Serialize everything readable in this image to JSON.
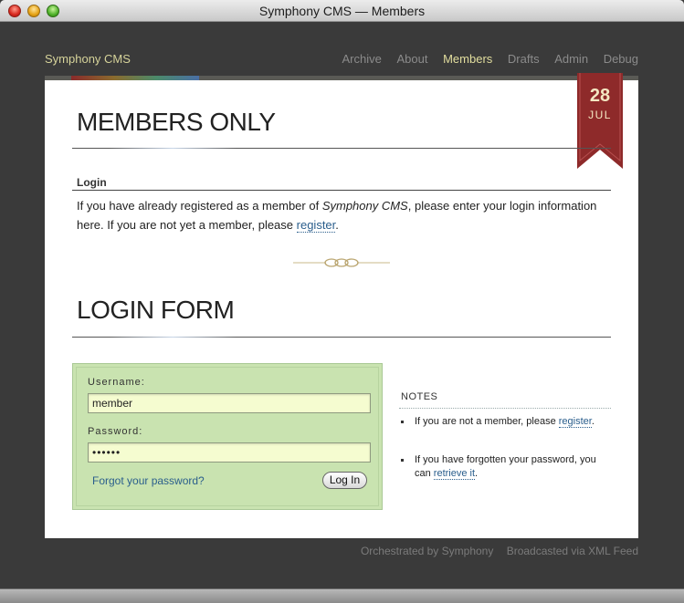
{
  "window": {
    "title": "Symphony CMS — Members"
  },
  "header": {
    "site_name": "Symphony CMS",
    "nav": [
      {
        "label": "Archive",
        "active": false
      },
      {
        "label": "About",
        "active": false
      },
      {
        "label": "Members",
        "active": true
      },
      {
        "label": "Drafts",
        "active": false
      },
      {
        "label": "Admin",
        "active": false
      },
      {
        "label": "Debug",
        "active": false
      }
    ]
  },
  "date_badge": {
    "day": "28",
    "month": "JUL"
  },
  "members_section": {
    "title": "MEMBERS ONLY",
    "subheading": "Login",
    "intro_prefix": "If you have already registered as a member of ",
    "intro_em": "Symphony CMS",
    "intro_mid": ", please enter your login information here. If you are not yet a member, please ",
    "register_link": "register",
    "intro_suffix": "."
  },
  "login_section": {
    "title": "LOGIN FORM",
    "username_label": "Username:",
    "username_value": "member",
    "password_label": "Password:",
    "password_value": "••••••",
    "forgot_link": "Forgot your password?",
    "submit_label": "Log In"
  },
  "notes": {
    "title": "NOTES",
    "note1_prefix": "If you are not a member, please ",
    "note1_link": "register",
    "note1_suffix": ".",
    "note2_prefix": "If you have forgotten your password, you can ",
    "note2_link": "retrieve it",
    "note2_suffix": "."
  },
  "footer": {
    "credit": "Orchestrated by Symphony",
    "feed": "Broadcasted via XML Feed"
  },
  "colors": {
    "background": "#3a3a3a",
    "panel": "#ffffff",
    "form_bg": "#c9e3b0",
    "input_bg": "#f5fcd0",
    "link": "#2a5e8c",
    "ribbon": "#8e2a2a",
    "active_nav": "#e2de9e"
  }
}
